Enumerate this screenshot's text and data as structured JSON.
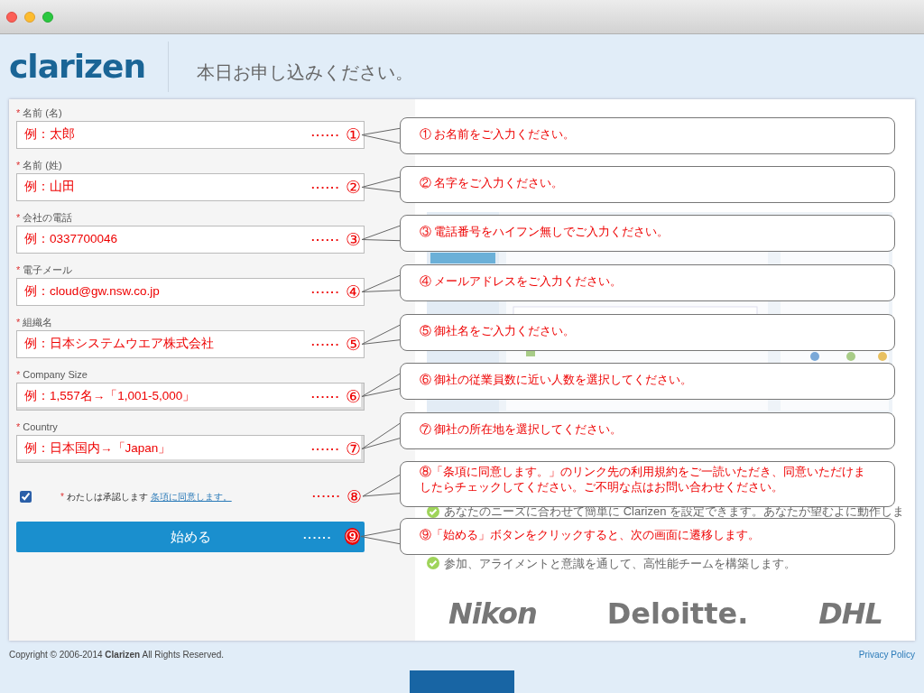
{
  "header": {
    "logo": "clarizen",
    "title": "本日お申し込みください。"
  },
  "form": {
    "fields": [
      {
        "label": "名前 (名)",
        "required_mark": "*",
        "kind": "text",
        "example": "例：太郎",
        "marker_dots": "······",
        "marker": "①"
      },
      {
        "label": "名前 (姓)",
        "required_mark": "*",
        "kind": "text",
        "example": "例：山田",
        "marker_dots": "······",
        "marker": "②"
      },
      {
        "label": "会社の電話",
        "required_mark": "*",
        "kind": "text",
        "example": "例：0337700046",
        "marker_dots": "······",
        "marker": "③"
      },
      {
        "label": "電子メール",
        "required_mark": "*",
        "kind": "text",
        "example": "例：cloud@gw.nsw.co.jp",
        "marker_dots": "······",
        "marker": "④"
      },
      {
        "label": "組織名",
        "required_mark": "*",
        "kind": "text",
        "example": "例：日本システムウエア株式会社",
        "marker_dots": "······",
        "marker": "⑤"
      },
      {
        "label": "Company Size",
        "required_mark": "*",
        "kind": "select",
        "example": "例：1,557名→「1,001-5,000」",
        "marker_dots": "······",
        "marker": "⑥"
      },
      {
        "label": "Country",
        "required_mark": "*",
        "kind": "select",
        "example": "例：日本国内→「Japan」",
        "marker_dots": "······",
        "marker": "⑦"
      }
    ],
    "agreement": {
      "checked": true,
      "required_mark": "*",
      "text": "わたしは承認します",
      "link": "条項に同意します。",
      "marker_dots": "······",
      "marker": "⑧"
    },
    "submit": {
      "label": "始める",
      "marker_dots": "······",
      "marker": "⑨"
    }
  },
  "callouts": [
    "① お名前をご入力ください。",
    "② 名字をご入力ください。",
    "③ 電話番号をハイフン無しでご入力ください。",
    "④ メールアドレスをご入力ください。",
    "⑤ 御社名をご入力ください。",
    "⑥ 御社の従業員数に近い人数を選択してください。",
    "⑦ 御社の所在地を選択してください。",
    "⑧「条項に同意します。」のリンク先の利用規約をご一読いただき、同意いただけましたらチェックしてください。ご不明な点はお問い合わせください。",
    "⑨「始める」ボタンをクリックすると、次の画面に遷移します。"
  ],
  "benefits": [
    "あなたのニーズに合わせて簡単に Clarizen を設定できます。あなたが望むよに動作しま",
    "参加、アライメントと意識を通して、高性能チームを構築します。"
  ],
  "logos": [
    "Nikon",
    "Deloitte.",
    "DHL"
  ],
  "footer": {
    "copyright": "Copyright © 2006-2014 **Clarizen** All Rights Reserved.",
    "privacy": "Privacy Policy"
  }
}
